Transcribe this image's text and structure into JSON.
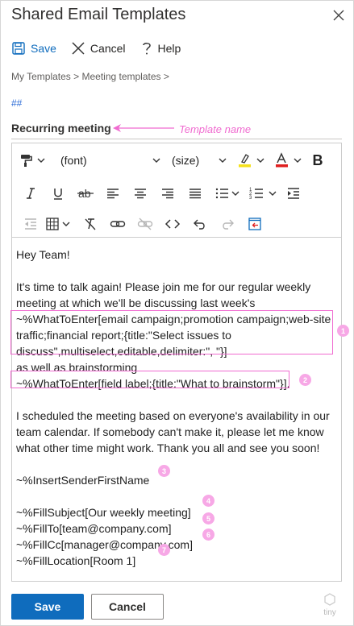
{
  "dialog": {
    "title": "Shared Email Templates"
  },
  "commands": {
    "save": "Save",
    "cancel": "Cancel",
    "help": "Help"
  },
  "breadcrumb": "My Templates > Meeting templates >",
  "hashtag": "##",
  "template_name": {
    "value": "Recurring meeting",
    "annotation": "Template name"
  },
  "toolbar": {
    "font": "(font)",
    "size": "(size)",
    "bold": "B",
    "highlight_color": "#f5e11b",
    "font_color": "#e02020"
  },
  "body": {
    "greeting": "Hey Team!",
    "para1_line1": "It's time to talk again! Please join me for our regular weekly",
    "para1_line2": "meeting at which we'll be discussing last week's",
    "macro1_line1": "~%WhatToEnter[email campaign;promotion campaign;web-site",
    "macro1_line2": "traffic;financial report;{title:\"Select issues to",
    "macro1_line3": "discuss\",multiselect,editable,delimiter:\", \"}]",
    "para1_tail": "as well as brainstorming",
    "macro2": "~%WhatToEnter[field label;{title:\"What to brainstorm\"}]",
    "macro2_punct": ".",
    "para2_line1": "I scheduled the meeting based on everyone's availability in our",
    "para2_line2": "team calendar. If somebody can't make it, please let me know",
    "para2_line3": "what other time might work. Thank you all and see you soon!",
    "sender": "~%InsertSenderFirstName",
    "subject": "~%FillSubject[Our weekly meeting]",
    "to": "~%FillTo[team@company.com]",
    "cc": "~%FillCc[manager@company.com]",
    "location": "~%FillLocation[Room 1]"
  },
  "badges": [
    "1",
    "2",
    "3",
    "4",
    "5",
    "6",
    "7"
  ],
  "watermark": "tiny",
  "footer": {
    "save": "Save",
    "cancel": "Cancel"
  },
  "colors": {
    "accent": "#0f6cbd",
    "annotation": "#f06bd0",
    "badge": "#f7a8e6"
  }
}
